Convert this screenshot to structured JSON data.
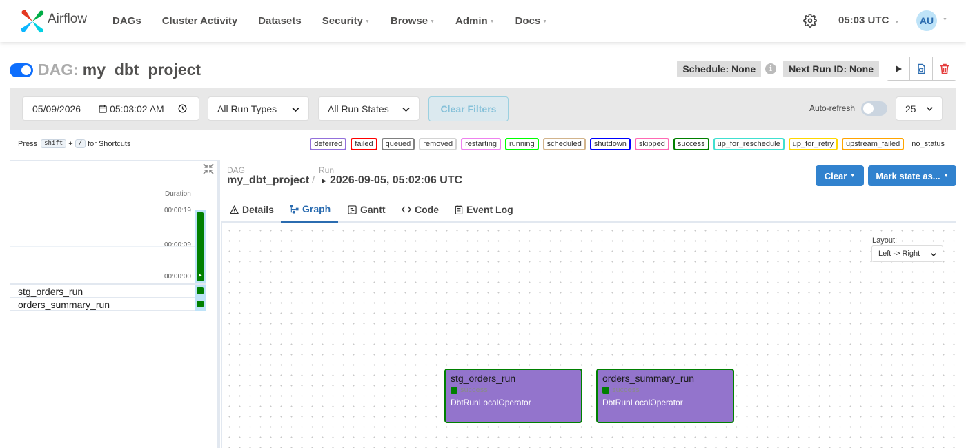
{
  "nav": {
    "brand": "Airflow",
    "items": [
      {
        "label": "DAGs",
        "dropdown": false
      },
      {
        "label": "Cluster Activity",
        "dropdown": false
      },
      {
        "label": "Datasets",
        "dropdown": false
      },
      {
        "label": "Security",
        "dropdown": true
      },
      {
        "label": "Browse",
        "dropdown": true
      },
      {
        "label": "Admin",
        "dropdown": true
      },
      {
        "label": "Docs",
        "dropdown": true
      }
    ],
    "time": "05:03 UTC",
    "user_initials": "AU"
  },
  "dag": {
    "label": "DAG:",
    "id": "my_dbt_project",
    "schedule": "Schedule: None",
    "next_run": "Next Run ID: None"
  },
  "filters": {
    "date": "05/09/2026",
    "time": "05:03:02  AM",
    "run_types": "All Run Types",
    "run_states": "All Run States",
    "clear_filters": "Clear Filters",
    "auto_refresh": "Auto-refresh",
    "num_runs": "25"
  },
  "shortcuts": {
    "press": "Press",
    "key1": "shift",
    "plus": "+",
    "key2": "/",
    "suffix": "for Shortcuts"
  },
  "legend": [
    {
      "label": "deferred",
      "color": "#9370db"
    },
    {
      "label": "failed",
      "color": "#ff0000"
    },
    {
      "label": "queued",
      "color": "#808080"
    },
    {
      "label": "removed",
      "color": "#d3d3d3"
    },
    {
      "label": "restarting",
      "color": "#ee82ee"
    },
    {
      "label": "running",
      "color": "#00ff00"
    },
    {
      "label": "scheduled",
      "color": "#d2b48c"
    },
    {
      "label": "shutdown",
      "color": "#0000ff"
    },
    {
      "label": "skipped",
      "color": "#ff69b4"
    },
    {
      "label": "success",
      "color": "#008000"
    },
    {
      "label": "up_for_reschedule",
      "color": "#40e0d0"
    },
    {
      "label": "up_for_retry",
      "color": "#ffd700"
    },
    {
      "label": "upstream_failed",
      "color": "#ffa500"
    }
  ],
  "legend_plain": "no_status",
  "grid": {
    "duration_label": "Duration",
    "ticks": [
      "00:00:19",
      "00:00:09",
      "00:00:00"
    ],
    "tasks": [
      "stg_orders_run",
      "orders_summary_run"
    ]
  },
  "breadcrumb": {
    "dag_label": "DAG",
    "dag_value": "my_dbt_project",
    "sep": "/",
    "run_label": "Run",
    "run_value": "2026-09-05, 05:02:06 UTC"
  },
  "actions": {
    "clear": "Clear",
    "mark_state": "Mark state as..."
  },
  "tabs": [
    "Details",
    "Graph",
    "Gantt",
    "Code",
    "Event Log"
  ],
  "graph": {
    "layout_label": "Layout:",
    "layout_value": "Left -> Right",
    "nodes": [
      {
        "name": "stg_orders_run",
        "status": "success",
        "operator": "DbtRunLocalOperator"
      },
      {
        "name": "orders_summary_run",
        "status": "success",
        "operator": "DbtRunLocalOperator"
      }
    ]
  },
  "colors": {
    "accent": "#3182ce",
    "success": "#008000",
    "node_fill": "#9374cc",
    "toggle_on": "#0d6efd"
  }
}
